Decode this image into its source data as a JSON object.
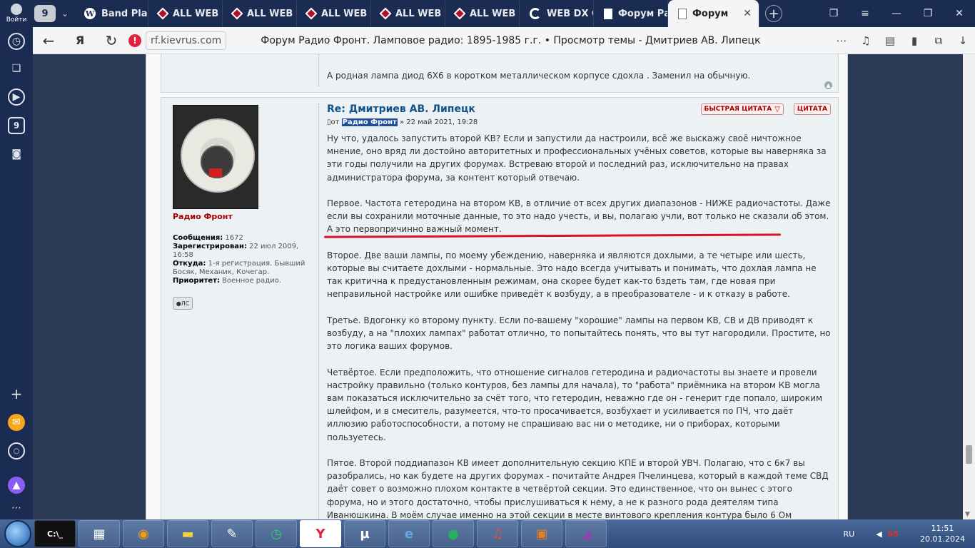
{
  "browser": {
    "profile_label": "Войти",
    "tab_count": "9",
    "tabs": [
      {
        "label": "Band Plan",
        "icon": "wordpress-icon"
      },
      {
        "label": "ALL WEB D",
        "icon": "diamond-icon"
      },
      {
        "label": "ALL WEB D",
        "icon": "diamond-icon"
      },
      {
        "label": "ALL WEB D",
        "icon": "diamond-icon"
      },
      {
        "label": "ALL WEB D",
        "icon": "diamond-icon"
      },
      {
        "label": "ALL WEB D",
        "icon": "diamond-icon"
      },
      {
        "label": "WEB DX C",
        "icon": "ring-icon"
      },
      {
        "label": "Форум Ра",
        "icon": "page-icon"
      },
      {
        "label": "Форум",
        "icon": "page-icon",
        "active": true
      }
    ],
    "url": "rf.kievrus.com",
    "page_title": "Форум Радио Фронт. Ламповое радио: 1895-1985 г.г. • Просмотр темы - Дмитриев АВ. Липецк",
    "sidebar_badge": "9"
  },
  "prev_post": {
    "text": "А родная лампа диод 6Х6 в коротком металлическом корпусе сдохла . Заменил на обычную."
  },
  "post": {
    "title": "Re: Дмитриев АВ. Липецк",
    "by_prefix": "от",
    "author": "Радио Фронт",
    "date": "» 22 май 2021, 19:28",
    "quick_quote": "БЫСТРАЯ ЦИТАТА",
    "quote": "ЦИТАТА",
    "paragraphs": [
      "Ну что, удалось запустить второй КВ? Если и запустили да настроили, всё же выскажу своё ничтожное мнение, оно вряд ли достойно авторитетных и профессиональных учёных советов, которые вы наверняка за эти годы получили на других форумах. Встреваю второй и последний раз, исключительно на правах администратора форума, за контент который отвечаю.",
      "Первое. Частота гетеродина на втором КВ, в отличие от всех других диапазонов - НИЖЕ радиочастоты. Даже если вы сохранили моточные данные, то это надо учесть, и вы, полагаю учли, вот только не сказали об этом. А это первопричинно важный момент.",
      "Второе. Две ваши лампы, по моему убеждению, наверняка и являются дохлыми, а те четыре или шесть, которые вы считаете дохлыми - нормальные. Это надо всегда учитывать и понимать, что дохлая лампа не так критична к предустановленным режимам, она скорее будет как-то бздеть там, где новая при неправильной настройке или ошибке приведёт к возбуду, а в преобразователе - и к отказу в работе.",
      "Третье. Вдогонку ко второму пункту. Если по-вашему \"хорошие\" лампы на первом КВ, СВ и ДВ приводят к возбуду, а на \"плохих лампах\" работат отлично, то попытайтесь понять, что вы тут нагородили. Простите, но это логика ваших форумов.",
      "Четвёртое. Если предположить, что отношение сигналов гетеродина и радиочастоты вы знаете и провели настройку правильно (только контуров, без лампы для начала), то \"работа\" приёмника на втором КВ могла вам показаться исключительно за счёт того, что гетеродин, неважно где он - генерит где попало, широким шлейфом, и в смеситель, разумеется, что-то просачивается, возбухает и усиливается по ПЧ, что даёт иллюзию работоспособности, а потому не спрашиваю вас ни о методике, ни о приборах, которыми пользуетесь.",
      "Пятое. Второй поддиапазон КВ имеет дополнительную секцию КПЕ и второй УВЧ. Полагаю, что с 6к7 вы разобрались, но как будете на других форумах - почитайте Андрея Пчелинцева, который в каждой теме СВД даёт совет о возможно плохом контакте в четвёртой секции. Это единственное, что он вынес с этого форума, но и этого достаточно, чтобы прислушиваться к нему, а не к разного рода деятелям типа Иванюшкина. В моём случае именно на этой секции в месте винтового крепления контура было 6 Ом сопротивление, что делало невозможным сопряжение. Даже не читая того, что гетеродин на 6д8 после 12 незаниудов затягивает частоту, почему его на"
    ]
  },
  "profile": {
    "name": "Радио Фронт",
    "posts_label": "Сообщения:",
    "posts_value": "1672",
    "registered_label": "Зарегистрирован:",
    "registered_value": "22 июл 2009, 16:58",
    "from_label": "Откуда:",
    "from_value": "1-я регистрация. Бывший Босяк, Механик, Кочегар.",
    "priority_label": "Приоритет:",
    "priority_value": "Военное радио.",
    "pm_label": "ЛС"
  },
  "taskbar": {
    "lang": "RU",
    "tray_number": "65",
    "time": "11:51",
    "date": "20.01.2024"
  }
}
